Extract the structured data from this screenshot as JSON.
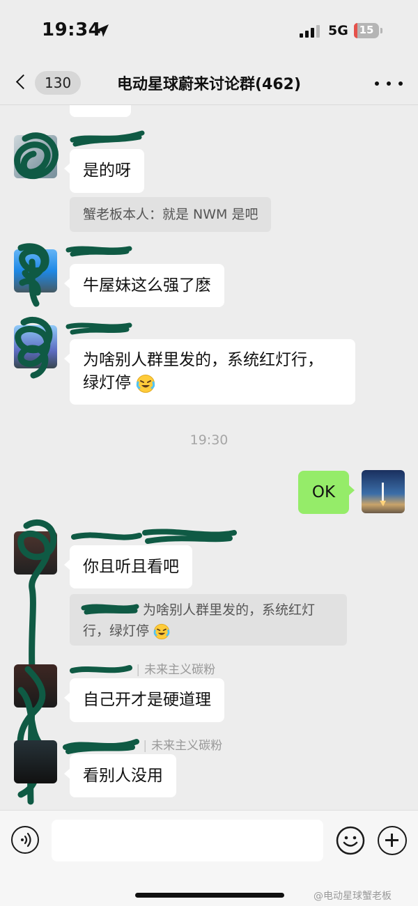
{
  "status_bar": {
    "time": "19:34",
    "network": "5G",
    "battery_level": "15",
    "battery_fraction": 0.15,
    "battery_color": "#e5524b",
    "icons": [
      "location-arrow-icon",
      "signal-icon"
    ]
  },
  "nav": {
    "back_count": "130",
    "title": "电动星球蔚来讨论群(462)",
    "icons": [
      "chevron-left-icon",
      "more-dots-icon"
    ]
  },
  "messages": {
    "m0": {
      "text": "是的呀"
    },
    "quote1": {
      "text": "蟹老板本人：就是 NWM 是吧"
    },
    "m1": {
      "text": "牛屋妹这么强了麽"
    },
    "m2": {
      "line1": "为啥别人群里发的，系统红灯行，",
      "line2": "绿灯停",
      "emoji": "laughing-crying-emoji"
    },
    "timestamp": "19:30",
    "m3": {
      "text": "OK"
    },
    "m4": {
      "text": "你且听且看吧"
    },
    "quote2": {
      "line1": "为啥别人群里发的，系统红灯",
      "line2": "行，绿灯停",
      "emoji": "laughing-crying-emoji"
    },
    "tag1": {
      "text": "未来主义碳粉"
    },
    "m5": {
      "text": "自己开才是硬道理"
    },
    "tag2": {
      "text": "未来主义碳粉"
    },
    "m6": {
      "text": "看别人没用"
    }
  },
  "colors": {
    "background": "#ededed",
    "own_bubble": "#95ec69",
    "other_bubble": "#ffffff",
    "redaction_marker": "#0f5a44"
  },
  "input_bar": {
    "icons": [
      "voice-icon",
      "emoji-icon",
      "plus-icon"
    ]
  },
  "watermark": {
    "text": "@电动星球蟹老板"
  }
}
